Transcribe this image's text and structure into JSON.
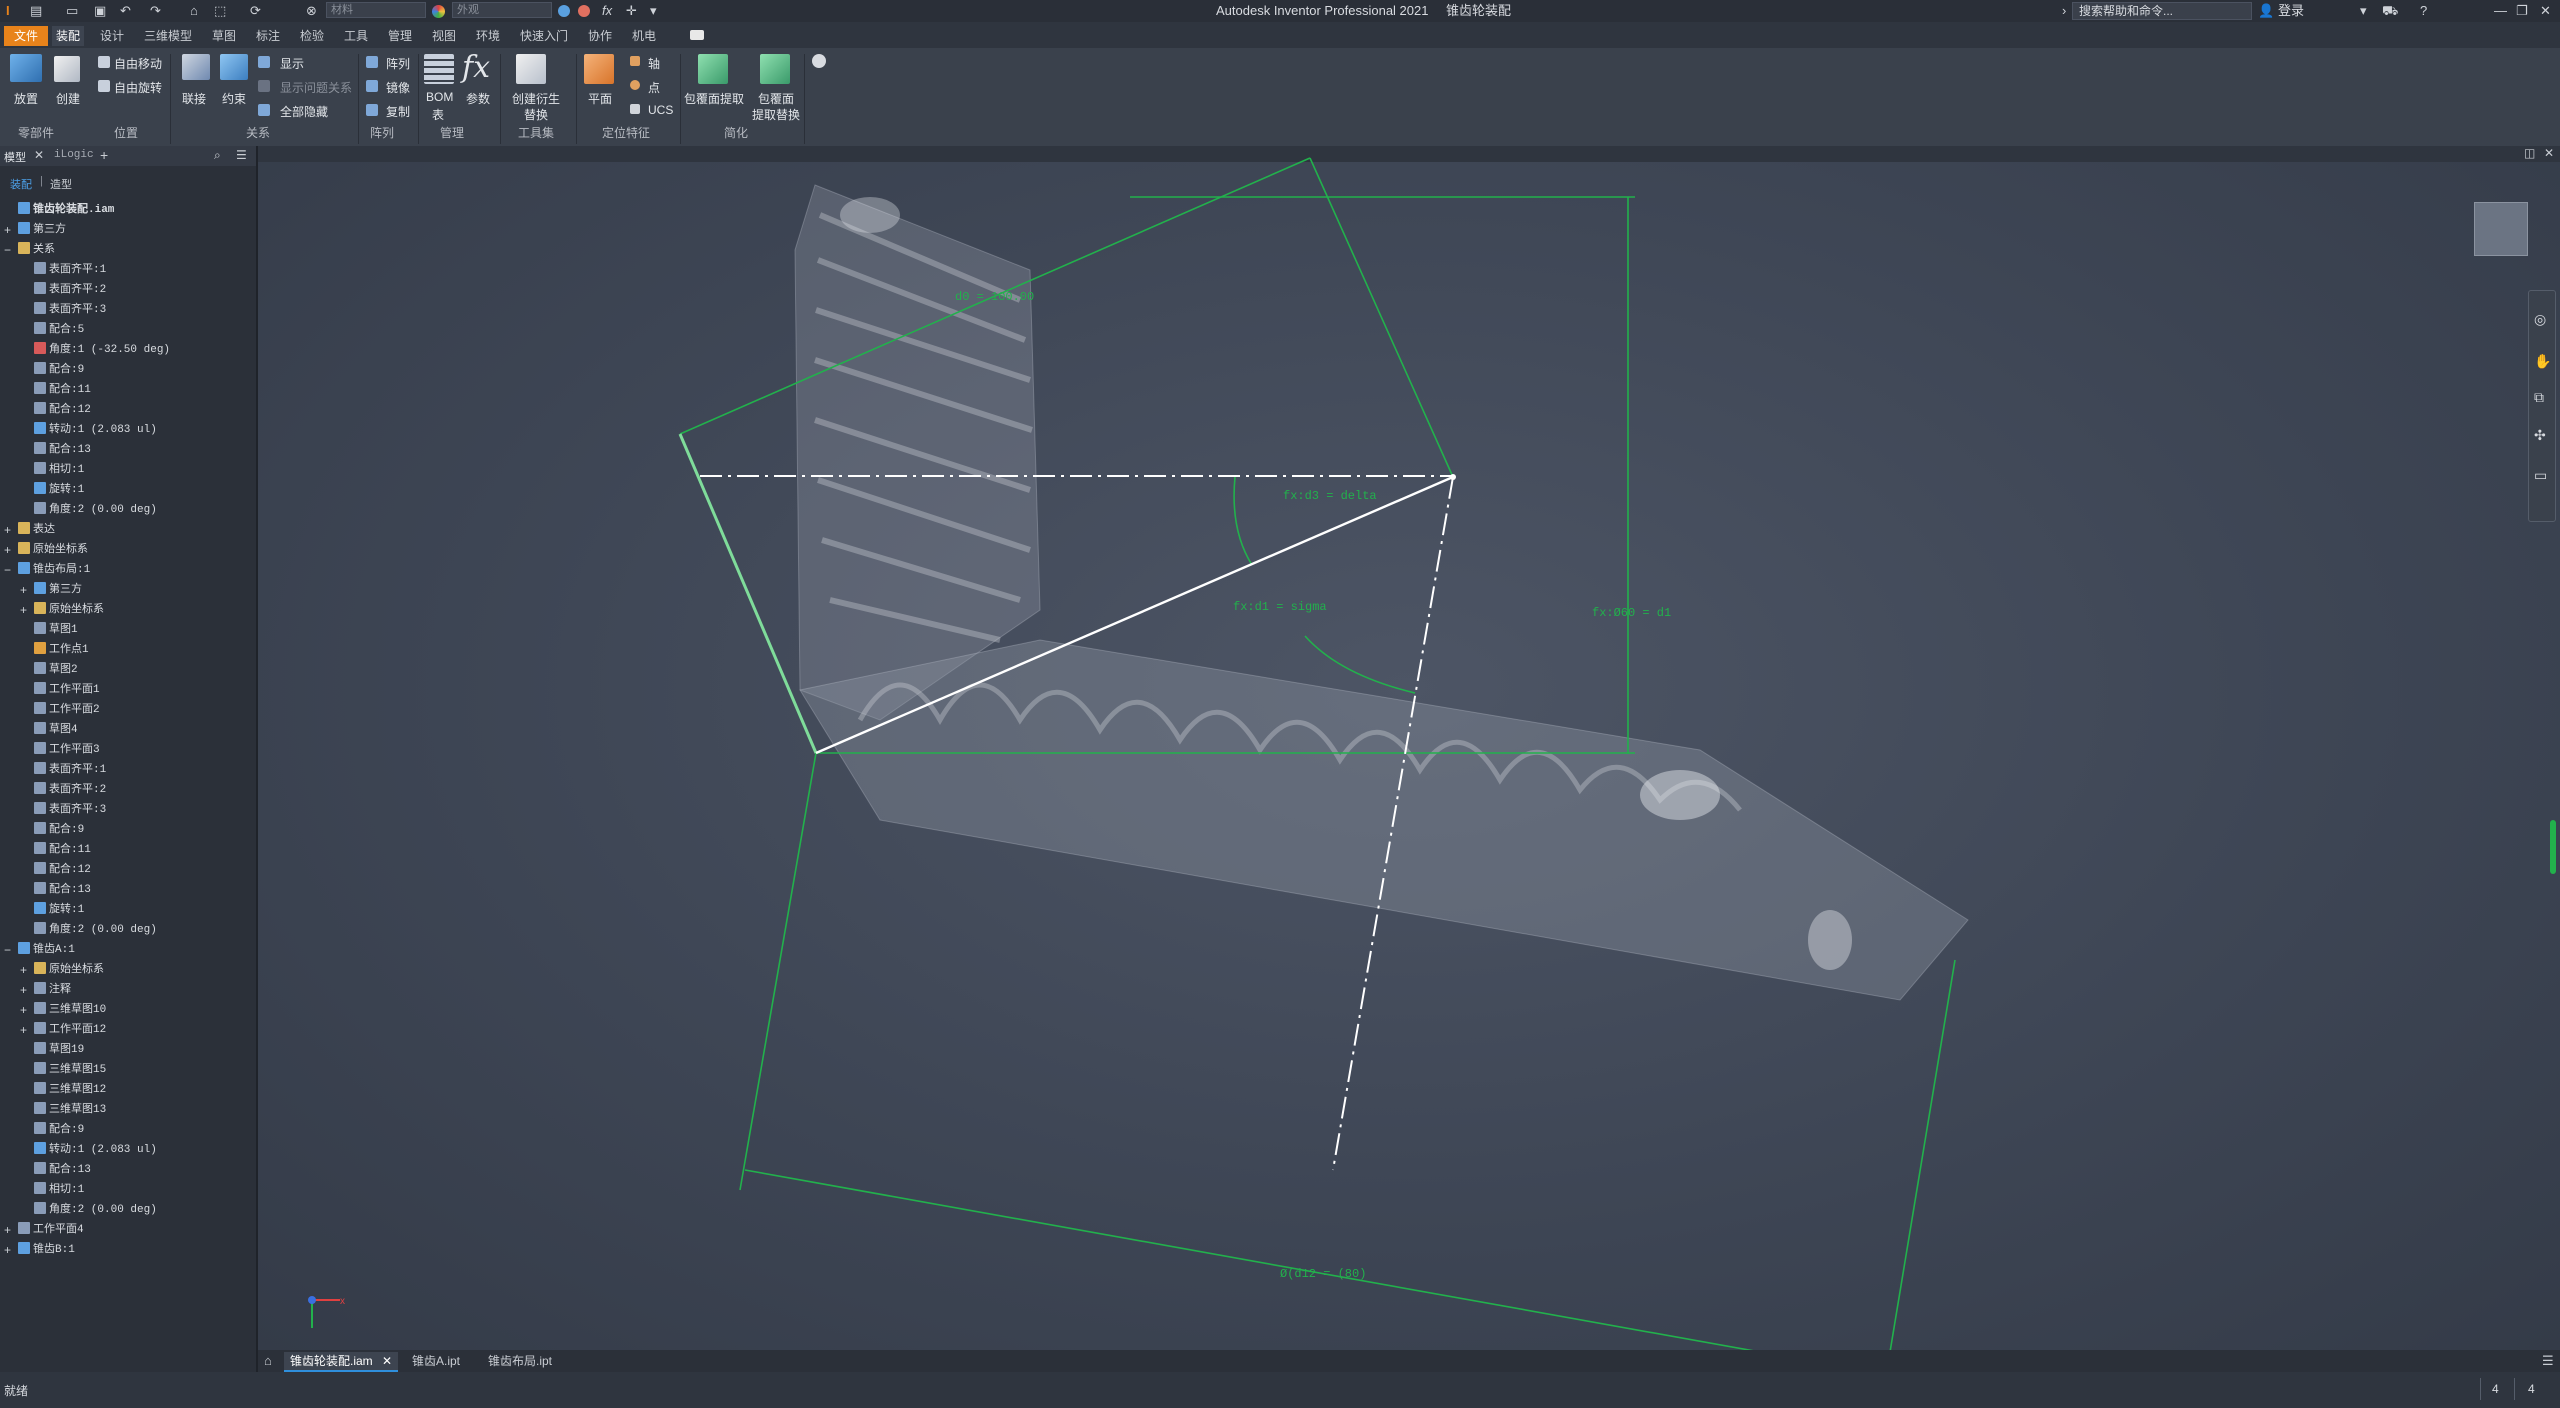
{
  "window": {
    "app_title": "Autodesk Inventor Professional 2021",
    "doc_title": "锥齿轮装配",
    "quick_material": "材料",
    "quick_appearance": "外观",
    "search_placeholder": "搜索帮助和命令...",
    "login": "登录"
  },
  "menu": {
    "file": "文件",
    "tabs": [
      "装配",
      "设计",
      "三维模型",
      "草图",
      "标注",
      "检验",
      "工具",
      "管理",
      "视图",
      "环境",
      "快速入门",
      "协作",
      "机电"
    ]
  },
  "ribbon": {
    "buttons": {
      "place": "放置",
      "create": "创建",
      "free_move": "自由移动",
      "free_rotate": "自由旋转",
      "join": "联接",
      "constrain": "约束",
      "show": "显示",
      "show_sick": "显示问题关系",
      "hide_all": "全部隐藏",
      "pattern": "阵列",
      "mirror": "镜像",
      "copy": "复制",
      "bom1": "BOM",
      "bom2": "表",
      "params": "参数",
      "derive1": "创建衍生",
      "derive2": "替换",
      "plane": "平面",
      "axis": "轴",
      "point": "点",
      "ucs": "UCS",
      "shrinkwrap": "包覆面提取",
      "shrink_sub1": "包覆面",
      "shrink_sub2": "提取替换"
    },
    "groups": [
      "零部件",
      "位置",
      "关系",
      "阵列",
      "管理",
      "工具集",
      "定位特征",
      "简化"
    ]
  },
  "browser": {
    "tab_model": "模型",
    "tab_ilogic": "iLogic",
    "sub_assembly": "装配",
    "sub_modeling": "造型",
    "items": [
      {
        "label": "锥齿轮装配.iam",
        "level": 0,
        "pm": "",
        "color": "#5ea0e0",
        "bold": true
      },
      {
        "label": "第三方",
        "level": 0,
        "pm": "+",
        "color": "#5ea0e0"
      },
      {
        "label": "关系",
        "level": 0,
        "pm": "−",
        "color": "#d9b45a"
      },
      {
        "label": "表面齐平:1",
        "level": 1,
        "pm": "",
        "color": "#8a9cb8"
      },
      {
        "label": "表面齐平:2",
        "level": 1,
        "pm": "",
        "color": "#8a9cb8"
      },
      {
        "label": "表面齐平:3",
        "level": 1,
        "pm": "",
        "color": "#8a9cb8"
      },
      {
        "label": "配合:5",
        "level": 1,
        "pm": "",
        "color": "#8a9cb8"
      },
      {
        "label": "角度:1 (-32.50 deg)",
        "level": 1,
        "pm": "",
        "color": "#d85a5a"
      },
      {
        "label": "配合:9",
        "level": 1,
        "pm": "",
        "color": "#8a9cb8"
      },
      {
        "label": "配合:11",
        "level": 1,
        "pm": "",
        "color": "#8a9cb8"
      },
      {
        "label": "配合:12",
        "level": 1,
        "pm": "",
        "color": "#8a9cb8"
      },
      {
        "label": "转动:1 (2.083 ul)",
        "level": 1,
        "pm": "",
        "color": "#5ea0e0"
      },
      {
        "label": "配合:13",
        "level": 1,
        "pm": "",
        "color": "#8a9cb8"
      },
      {
        "label": "相切:1",
        "level": 1,
        "pm": "",
        "color": "#8a9cb8"
      },
      {
        "label": "旋转:1",
        "level": 1,
        "pm": "",
        "color": "#5ea0e0"
      },
      {
        "label": "角度:2 (0.00 deg)",
        "level": 1,
        "pm": "",
        "color": "#8a9cb8"
      },
      {
        "label": "表达",
        "level": 0,
        "pm": "+",
        "color": "#d9b45a"
      },
      {
        "label": "原始坐标系",
        "level": 0,
        "pm": "+",
        "color": "#d9b45a"
      },
      {
        "label": "锥齿布局:1",
        "level": 0,
        "pm": "−",
        "color": "#5ea0e0"
      },
      {
        "label": "第三方",
        "level": 1,
        "pm": "+",
        "color": "#5ea0e0"
      },
      {
        "label": "原始坐标系",
        "level": 1,
        "pm": "+",
        "color": "#d9b45a"
      },
      {
        "label": "草图1",
        "level": 1,
        "pm": "",
        "color": "#8a9cb8"
      },
      {
        "label": "工作点1",
        "level": 1,
        "pm": "",
        "color": "#e0a040"
      },
      {
        "label": "草图2",
        "level": 1,
        "pm": "",
        "color": "#8a9cb8"
      },
      {
        "label": "工作平面1",
        "level": 1,
        "pm": "",
        "color": "#8a9cb8"
      },
      {
        "label": "工作平面2",
        "level": 1,
        "pm": "",
        "color": "#8a9cb8"
      },
      {
        "label": "草图4",
        "level": 1,
        "pm": "",
        "color": "#8a9cb8"
      },
      {
        "label": "工作平面3",
        "level": 1,
        "pm": "",
        "color": "#8a9cb8"
      },
      {
        "label": "表面齐平:1",
        "level": 1,
        "pm": "",
        "color": "#8a9cb8"
      },
      {
        "label": "表面齐平:2",
        "level": 1,
        "pm": "",
        "color": "#8a9cb8"
      },
      {
        "label": "表面齐平:3",
        "level": 1,
        "pm": "",
        "color": "#8a9cb8"
      },
      {
        "label": "配合:9",
        "level": 1,
        "pm": "",
        "color": "#8a9cb8"
      },
      {
        "label": "配合:11",
        "level": 1,
        "pm": "",
        "color": "#8a9cb8"
      },
      {
        "label": "配合:12",
        "level": 1,
        "pm": "",
        "color": "#8a9cb8"
      },
      {
        "label": "配合:13",
        "level": 1,
        "pm": "",
        "color": "#8a9cb8"
      },
      {
        "label": "旋转:1",
        "level": 1,
        "pm": "",
        "color": "#5ea0e0"
      },
      {
        "label": "角度:2 (0.00 deg)",
        "level": 1,
        "pm": "",
        "color": "#8a9cb8"
      },
      {
        "label": "锥齿A:1",
        "level": 0,
        "pm": "−",
        "color": "#5ea0e0"
      },
      {
        "label": "原始坐标系",
        "level": 1,
        "pm": "+",
        "color": "#d9b45a"
      },
      {
        "label": "注释",
        "level": 1,
        "pm": "+",
        "color": "#8a9cb8"
      },
      {
        "label": "三维草图10",
        "level": 1,
        "pm": "+",
        "color": "#8a9cb8"
      },
      {
        "label": "工作平面12",
        "level": 1,
        "pm": "+",
        "color": "#8a9cb8"
      },
      {
        "label": "草图19",
        "level": 1,
        "pm": "",
        "color": "#8a9cb8"
      },
      {
        "label": "三维草图15",
        "level": 1,
        "pm": "",
        "color": "#8a9cb8"
      },
      {
        "label": "三维草图12",
        "level": 1,
        "pm": "",
        "color": "#8a9cb8"
      },
      {
        "label": "三维草图13",
        "level": 1,
        "pm": "",
        "color": "#8a9cb8"
      },
      {
        "label": "配合:9",
        "level": 1,
        "pm": "",
        "color": "#8a9cb8"
      },
      {
        "label": "转动:1 (2.083 ul)",
        "level": 1,
        "pm": "",
        "color": "#5ea0e0"
      },
      {
        "label": "配合:13",
        "level": 1,
        "pm": "",
        "color": "#8a9cb8"
      },
      {
        "label": "相切:1",
        "level": 1,
        "pm": "",
        "color": "#8a9cb8"
      },
      {
        "label": "角度:2 (0.00 deg)",
        "level": 1,
        "pm": "",
        "color": "#8a9cb8"
      },
      {
        "label": "工作平面4",
        "level": 0,
        "pm": "+",
        "color": "#8a9cb8"
      },
      {
        "label": "锥齿B:1",
        "level": 0,
        "pm": "+",
        "color": "#5ea0e0"
      }
    ]
  },
  "viewport": {
    "dim_top": "d0 = 100.00",
    "dim_delta": "fx:d3 = delta",
    "dim_sigma": "fx:d1 = sigma",
    "dim_right": "fx:Ø60 = d1",
    "dim_bottom": "Ø(d12 = (80)",
    "axis_x": "x",
    "accent_green": "#22b14c"
  },
  "doc_tabs": [
    "锥齿轮装配.iam",
    "锥齿A.ipt",
    "锥齿布局.ipt"
  ],
  "status": {
    "left": "就绪",
    "num1": "4",
    "num2": "4"
  }
}
